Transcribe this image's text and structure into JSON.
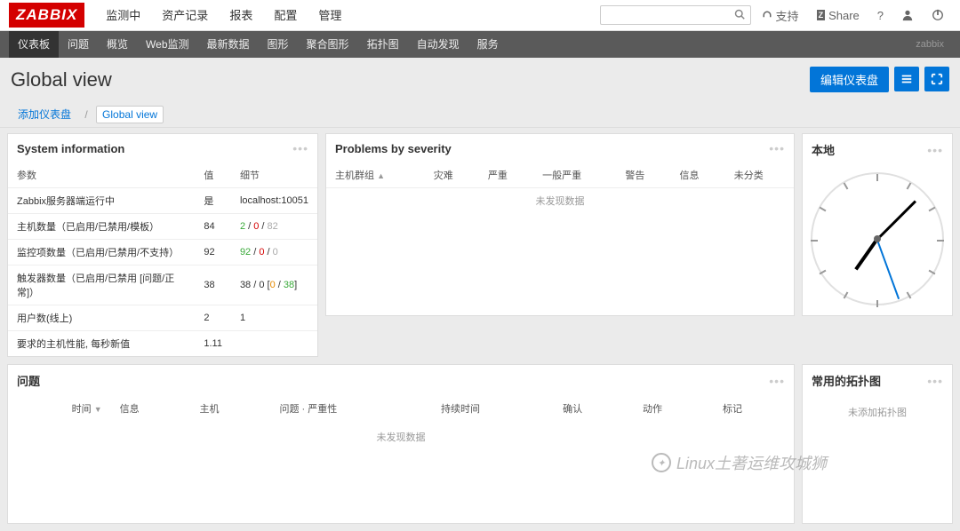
{
  "logo": "ZABBIX",
  "topnav": [
    "监测中",
    "资产记录",
    "报表",
    "配置",
    "管理"
  ],
  "topnav_right": {
    "support": "支持",
    "share": "Share"
  },
  "subnav": [
    "仪表板",
    "问题",
    "概览",
    "Web监测",
    "最新数据",
    "图形",
    "聚合图形",
    "拓扑图",
    "自动发现",
    "服务"
  ],
  "subnav_right": "zabbix",
  "page_title": "Global view",
  "edit_dashboard": "编辑仪表盘",
  "breadcrumb": {
    "add": "添加仪表盘",
    "current": "Global view"
  },
  "sysinfo": {
    "title": "System information",
    "cols": [
      "参数",
      "值",
      "细节"
    ],
    "rows": [
      {
        "p": "Zabbix服务器端运行中",
        "v": "是",
        "d": "localhost:10051",
        "vclass": "green"
      },
      {
        "p": "主机数量（已启用/已禁用/模板）",
        "v": "84",
        "d": {
          "a": "2",
          "b": "0",
          "c": "82",
          "ac": "green",
          "bc": "red",
          "cc": "gray"
        }
      },
      {
        "p": "监控项数量（已启用/已禁用/不支持）",
        "v": "92",
        "d": {
          "a": "92",
          "b": "0",
          "c": "0",
          "ac": "green",
          "bc": "red",
          "cc": "gray"
        }
      },
      {
        "p": "触发器数量（已启用/已禁用 [问题/正常]）",
        "v": "38",
        "d": {
          "a": "38 / 0",
          "b": "0",
          "c": "38",
          "prefix": "",
          "ac": "",
          "bc": "orange",
          "cc": "green",
          "bracket": true
        }
      },
      {
        "p": "用户数(线上)",
        "v": "2",
        "d": "1",
        "dclass": "green"
      },
      {
        "p": "要求的主机性能, 每秒新值",
        "v": "1.11",
        "d": ""
      }
    ]
  },
  "severity": {
    "title": "Problems by severity",
    "cols": [
      "主机群组",
      "灾难",
      "严重",
      "一般严重",
      "警告",
      "信息",
      "未分类"
    ],
    "no_data": "未发现数据"
  },
  "local": {
    "title": "本地"
  },
  "problems": {
    "title": "问题",
    "cols": [
      "时间",
      "信息",
      "主机",
      "问题 · 严重性",
      "持续时间",
      "确认",
      "动作",
      "标记"
    ],
    "no_data": "未发现数据"
  },
  "topology": {
    "title": "常用的拓扑图",
    "no_data": "未添加拓扑图"
  },
  "watermark": "Linux土著运维攻城狮"
}
